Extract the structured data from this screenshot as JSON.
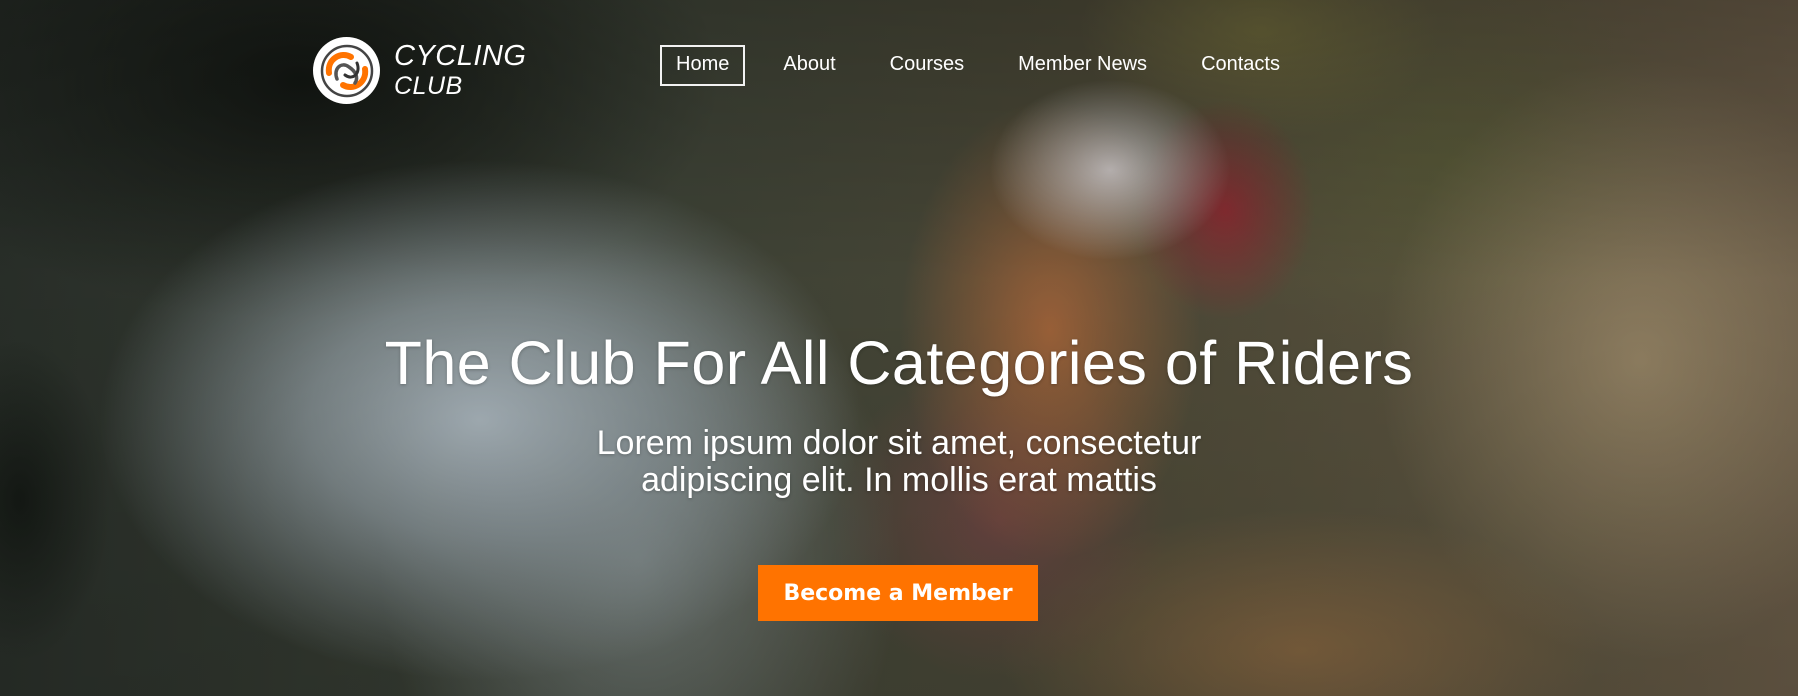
{
  "brand": {
    "line1": "CYCLING",
    "line2": "CLUB",
    "accent_color": "#ff7300"
  },
  "nav": {
    "items": [
      {
        "label": "Home",
        "active": true
      },
      {
        "label": "About",
        "active": false
      },
      {
        "label": "Courses",
        "active": false
      },
      {
        "label": "Member News",
        "active": false
      },
      {
        "label": "Contacts",
        "active": false
      }
    ]
  },
  "hero": {
    "headline": "The Club For All Categories of Riders",
    "subline_1": "Lorem ipsum dolor sit amet, consectetur",
    "subline_2": "adipiscing elit. In mollis erat mattis",
    "cta_label": "Become a Member",
    "cta_color": "#ff7300"
  }
}
